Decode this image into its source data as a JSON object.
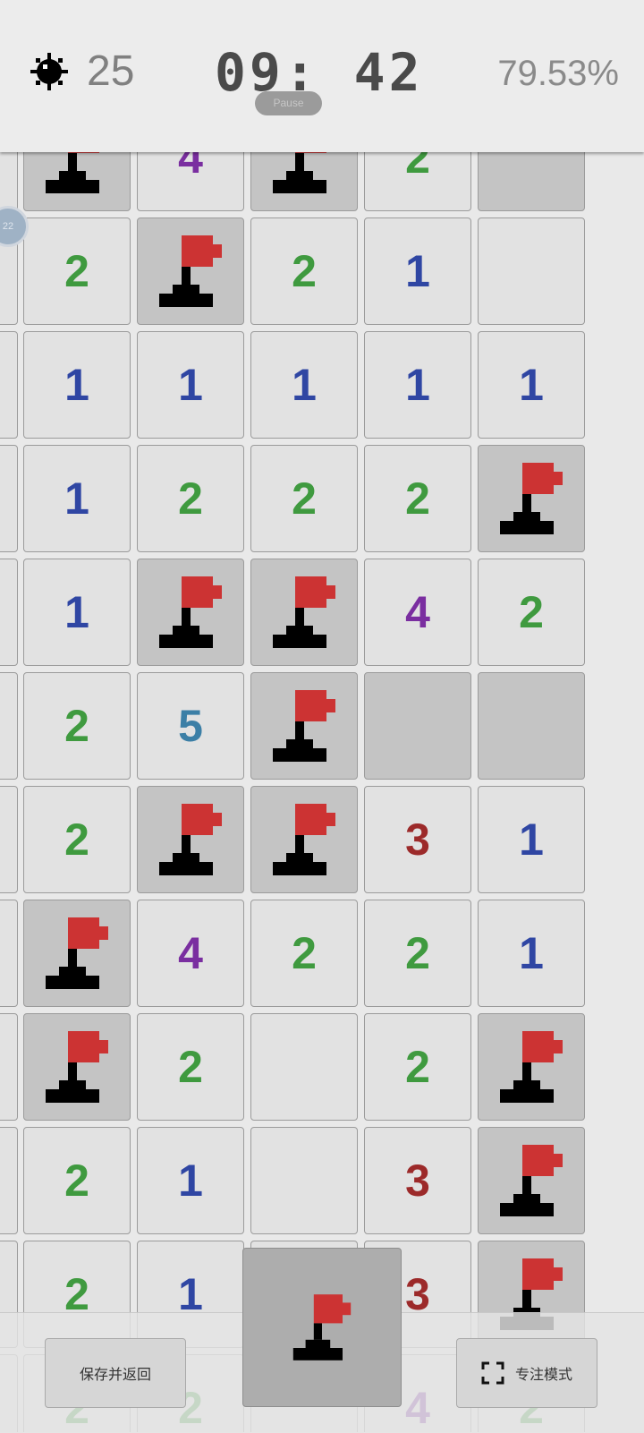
{
  "header": {
    "mines_remaining": "25",
    "timer": "09: 42",
    "pause_label": "Pause",
    "progress": "79.53%",
    "mine_icon": "mine-icon"
  },
  "board": {
    "rows": [
      [
        "flag",
        "4",
        "flag",
        "2",
        "shaded"
      ],
      [
        "2",
        "flag",
        "2",
        "1",
        ""
      ],
      [
        "1",
        "1",
        "1",
        "1",
        "1"
      ],
      [
        "1",
        "2",
        "2",
        "2",
        "flag"
      ],
      [
        "1",
        "flag",
        "flag",
        "4",
        "2"
      ],
      [
        "2",
        "5",
        "flag",
        "shaded",
        "shaded"
      ],
      [
        "2",
        "flag",
        "flag",
        "3",
        "1"
      ],
      [
        "flag",
        "4",
        "2",
        "2",
        "1"
      ],
      [
        "flag",
        "2",
        "",
        "2",
        "flag"
      ],
      [
        "2",
        "1",
        "",
        "3",
        "flag"
      ],
      [
        "2",
        "1",
        "",
        "3",
        "flag"
      ],
      [
        "2",
        "2",
        "",
        "4",
        "2"
      ]
    ],
    "number_colors": {
      "1": "#2f46a3",
      "2": "#3f9a3f",
      "3": "#9c2a2a",
      "4": "#7a2ea0",
      "5": "#3c7fa6"
    },
    "hint_badge": "22"
  },
  "bottom_bar": {
    "save_label": "保存并返回",
    "focus_label": "专注模式",
    "focus_icon": "fullscreen-icon",
    "mode_icon": "flag-icon"
  }
}
